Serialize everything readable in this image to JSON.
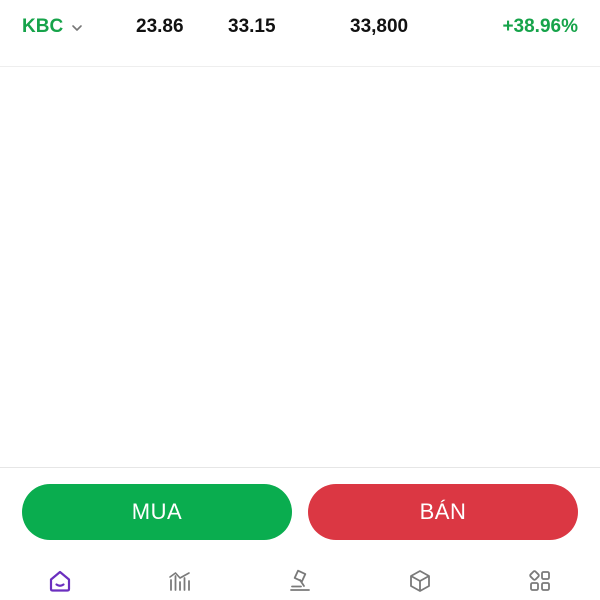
{
  "colors": {
    "up_green": "#16a34a",
    "buy_green": "#0aad4f",
    "sell_red": "#db3743",
    "nav_active": "#6b2fbf",
    "nav_inactive": "#7a7a7a"
  },
  "stock": {
    "symbol": "KBC",
    "symbol_icon": "chevron-down-icon",
    "price_1": "23.86",
    "price_2": "33.15",
    "volume": "33,800",
    "change_pct": "+38.96%"
  },
  "actions": {
    "buy_label": "MUA",
    "sell_label": "BÁN"
  },
  "bottom_nav": {
    "items": [
      {
        "icon": "home-icon",
        "active": true
      },
      {
        "icon": "market-chart-icon",
        "active": false
      },
      {
        "icon": "auction-hammer-icon",
        "active": false
      },
      {
        "icon": "box-icon",
        "active": false
      },
      {
        "icon": "apps-grid-icon",
        "active": false
      }
    ]
  }
}
